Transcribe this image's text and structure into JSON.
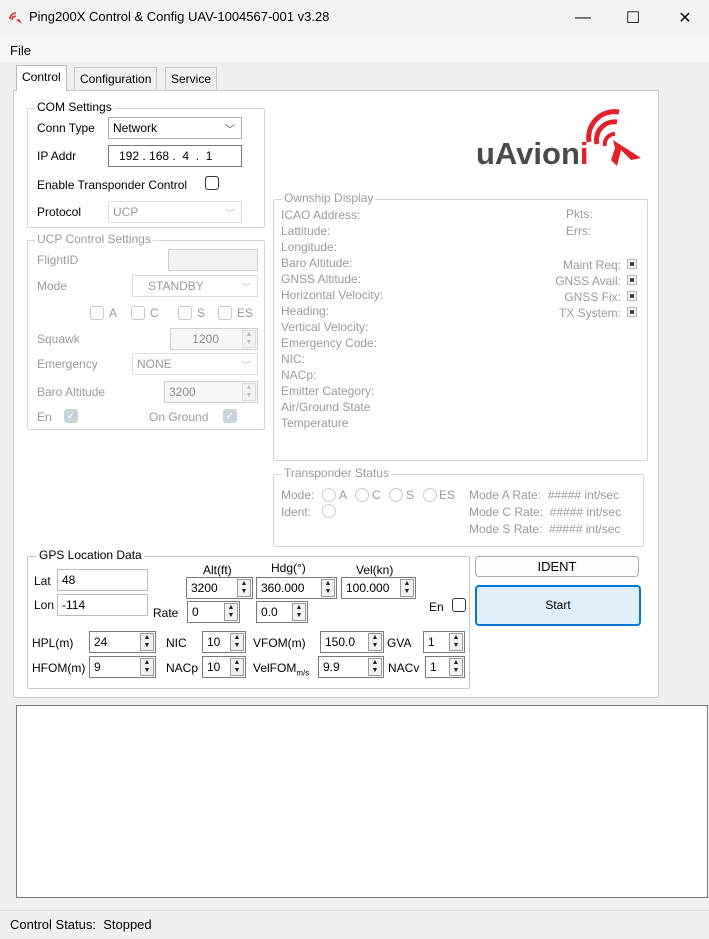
{
  "window": {
    "title": "Ping200X Control & Config UAV-1004567-001 v3.28",
    "icon": "uavionix-wifi-logo-icon",
    "controls": {
      "minimize": "—",
      "maximize": "☐",
      "close": "✕"
    }
  },
  "menu": {
    "file": "File"
  },
  "tabs": [
    {
      "label": "Control",
      "active": true
    },
    {
      "label": "Configuration",
      "active": false
    },
    {
      "label": "Service",
      "active": false
    }
  ],
  "com_settings": {
    "title": "COM Settings",
    "conn_type_label": "Conn Type",
    "conn_type_value": "Network",
    "ip_addr_label": "IP Addr",
    "ip_addr_value": "192 . 168 .  4  .  1",
    "enable_transponder_label": "Enable Transponder Control",
    "protocol_label": "Protocol",
    "protocol_value": "UCP"
  },
  "ucp_control": {
    "title": "UCP Control Settings",
    "flight_id_label": "FlightID",
    "flight_id_value": "",
    "mode_label": "Mode",
    "mode_value": "STANDBY",
    "mode_checks": [
      "A",
      "C",
      "S",
      "ES"
    ],
    "squawk_label": "Squawk",
    "squawk_value": "1200",
    "emergency_label": "Emergency",
    "emergency_value": "NONE",
    "baro_alt_label": "Baro Altitude",
    "baro_alt_value": "3200",
    "en_label": "En",
    "on_ground_label": "On Ground"
  },
  "logo": {
    "text_main": "uAvion",
    "text_accent": "i",
    "brand_color": "#e2202a",
    "text_color": "#4a4a4a"
  },
  "ownship": {
    "title": "Ownship Display",
    "fields": [
      "ICAO Address:",
      "Lattitude:",
      "Longitude:",
      "Baro Altitude:",
      "GNSS Altitude:",
      "Horizontal Velocity:",
      "Heading:",
      "Vertical Velocity:",
      "Emergency Code:",
      "NIC:",
      "NACp:",
      "Emitter Category:",
      "Air/Ground State",
      "Temperature"
    ],
    "pkts_label": "Pkts:",
    "errs_label": "Errs:",
    "indicators": [
      "Maint Req:",
      "GNSS Avail:",
      "GNSS Fix:",
      "TX System:"
    ]
  },
  "transponder_status": {
    "title": "Transponder Status",
    "mode_label": "Mode:",
    "mode_opts": [
      "A",
      "C",
      "S",
      "ES"
    ],
    "ident_label": "Ident:",
    "rates": [
      "Mode A Rate:  ##### int/sec",
      "Mode C Rate:  ##### int/sec",
      "Mode S Rate:  ##### int/sec"
    ]
  },
  "gps": {
    "title": "GPS Location Data",
    "lat_label": "Lat",
    "lat_value": "48",
    "lon_label": "Lon",
    "lon_value": "-114",
    "alt_label": "Alt(ft)",
    "alt_value": "3200",
    "hdg_label": "Hdg(°)",
    "hdg_value": "360.000",
    "vel_label": "Vel(kn)",
    "vel_value": "100.000",
    "rate_label": "Rate",
    "rate_value": "0",
    "rate2_value": "0.0",
    "en_label": "En",
    "hpl_label": "HPL(m)",
    "hpl_value": "24",
    "nic_label": "NIC",
    "nic_value": "10",
    "vfom_label": "VFOM(m)",
    "vfom_value": "150.0",
    "gva_label": "GVA",
    "gva_value": "1",
    "hfom_label": "HFOM(m)",
    "hfom_value": "9",
    "nacp_label": "NACp",
    "nacp_value": "10",
    "velfom_label": "VelFOM",
    "velfom_sub": "m/s",
    "velfom_value": "9.9",
    "nacv_label": "NACv",
    "nacv_value": "1"
  },
  "buttons": {
    "ident": "IDENT",
    "start": "Start"
  },
  "status": {
    "text": "Control Status:  Stopped"
  }
}
